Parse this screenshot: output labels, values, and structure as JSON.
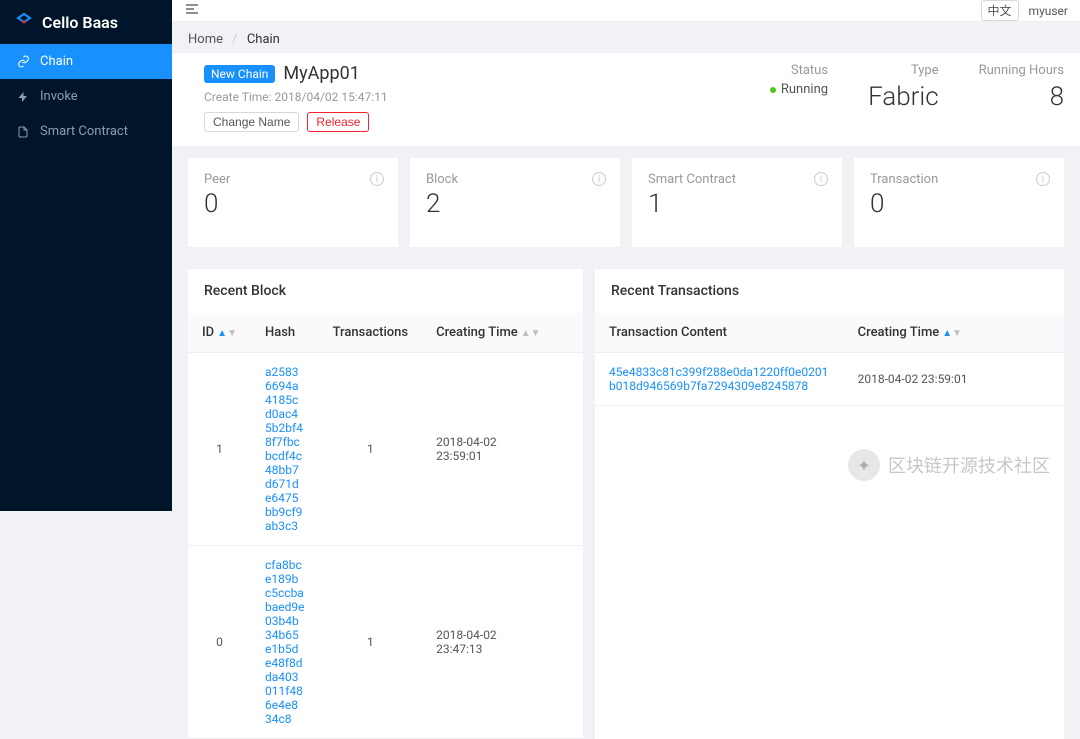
{
  "brand": "Cello Baas",
  "sidebar": {
    "items": [
      {
        "label": "Chain"
      },
      {
        "label": "Invoke"
      },
      {
        "label": "Smart Contract"
      }
    ]
  },
  "topbar": {
    "lang": "中文",
    "user": "myuser"
  },
  "breadcrumb": {
    "home": "Home",
    "current": "Chain"
  },
  "header": {
    "badge": "New Chain",
    "app_name": "MyApp01",
    "create_label": "Create Time:",
    "create_time": "2018/04/02 15:47:11",
    "change_name": "Change Name",
    "release": "Release",
    "status_label": "Status",
    "status_value": "Running",
    "type_label": "Type",
    "type_value": "Fabric",
    "hours_label": "Running Hours",
    "hours_value": "8"
  },
  "stats": [
    {
      "label": "Peer",
      "value": "0"
    },
    {
      "label": "Block",
      "value": "2"
    },
    {
      "label": "Smart Contract",
      "value": "1"
    },
    {
      "label": "Transaction",
      "value": "0"
    }
  ],
  "blocks": {
    "title": "Recent Block",
    "cols": {
      "id": "ID",
      "hash": "Hash",
      "tx": "Transactions",
      "time": "Creating Time"
    },
    "rows": [
      {
        "id": "1",
        "hash": "a25836694a4185cd0ac45b2bf48f7fbcbcdf4c48bb7d671de6475bb9cf9ab3c3",
        "tx": "1",
        "time": "2018-04-02 23:59:01"
      },
      {
        "id": "0",
        "hash": "cfa8bce189bc5ccbabaed9e03b4b34b65e1b5de48f8dda403011f486e4e834c8",
        "tx": "1",
        "time": "2018-04-02 23:47:13"
      }
    ]
  },
  "transactions": {
    "title": "Recent Transactions",
    "cols": {
      "content": "Transaction Content",
      "time": "Creating Time"
    },
    "rows": [
      {
        "content": "45e4833c81c399f288e0da1220ff0e0201b018d946569b7fa7294309e8245878",
        "time": "2018-04-02 23:59:01"
      }
    ]
  },
  "watermark": "区块链开源技术社区"
}
